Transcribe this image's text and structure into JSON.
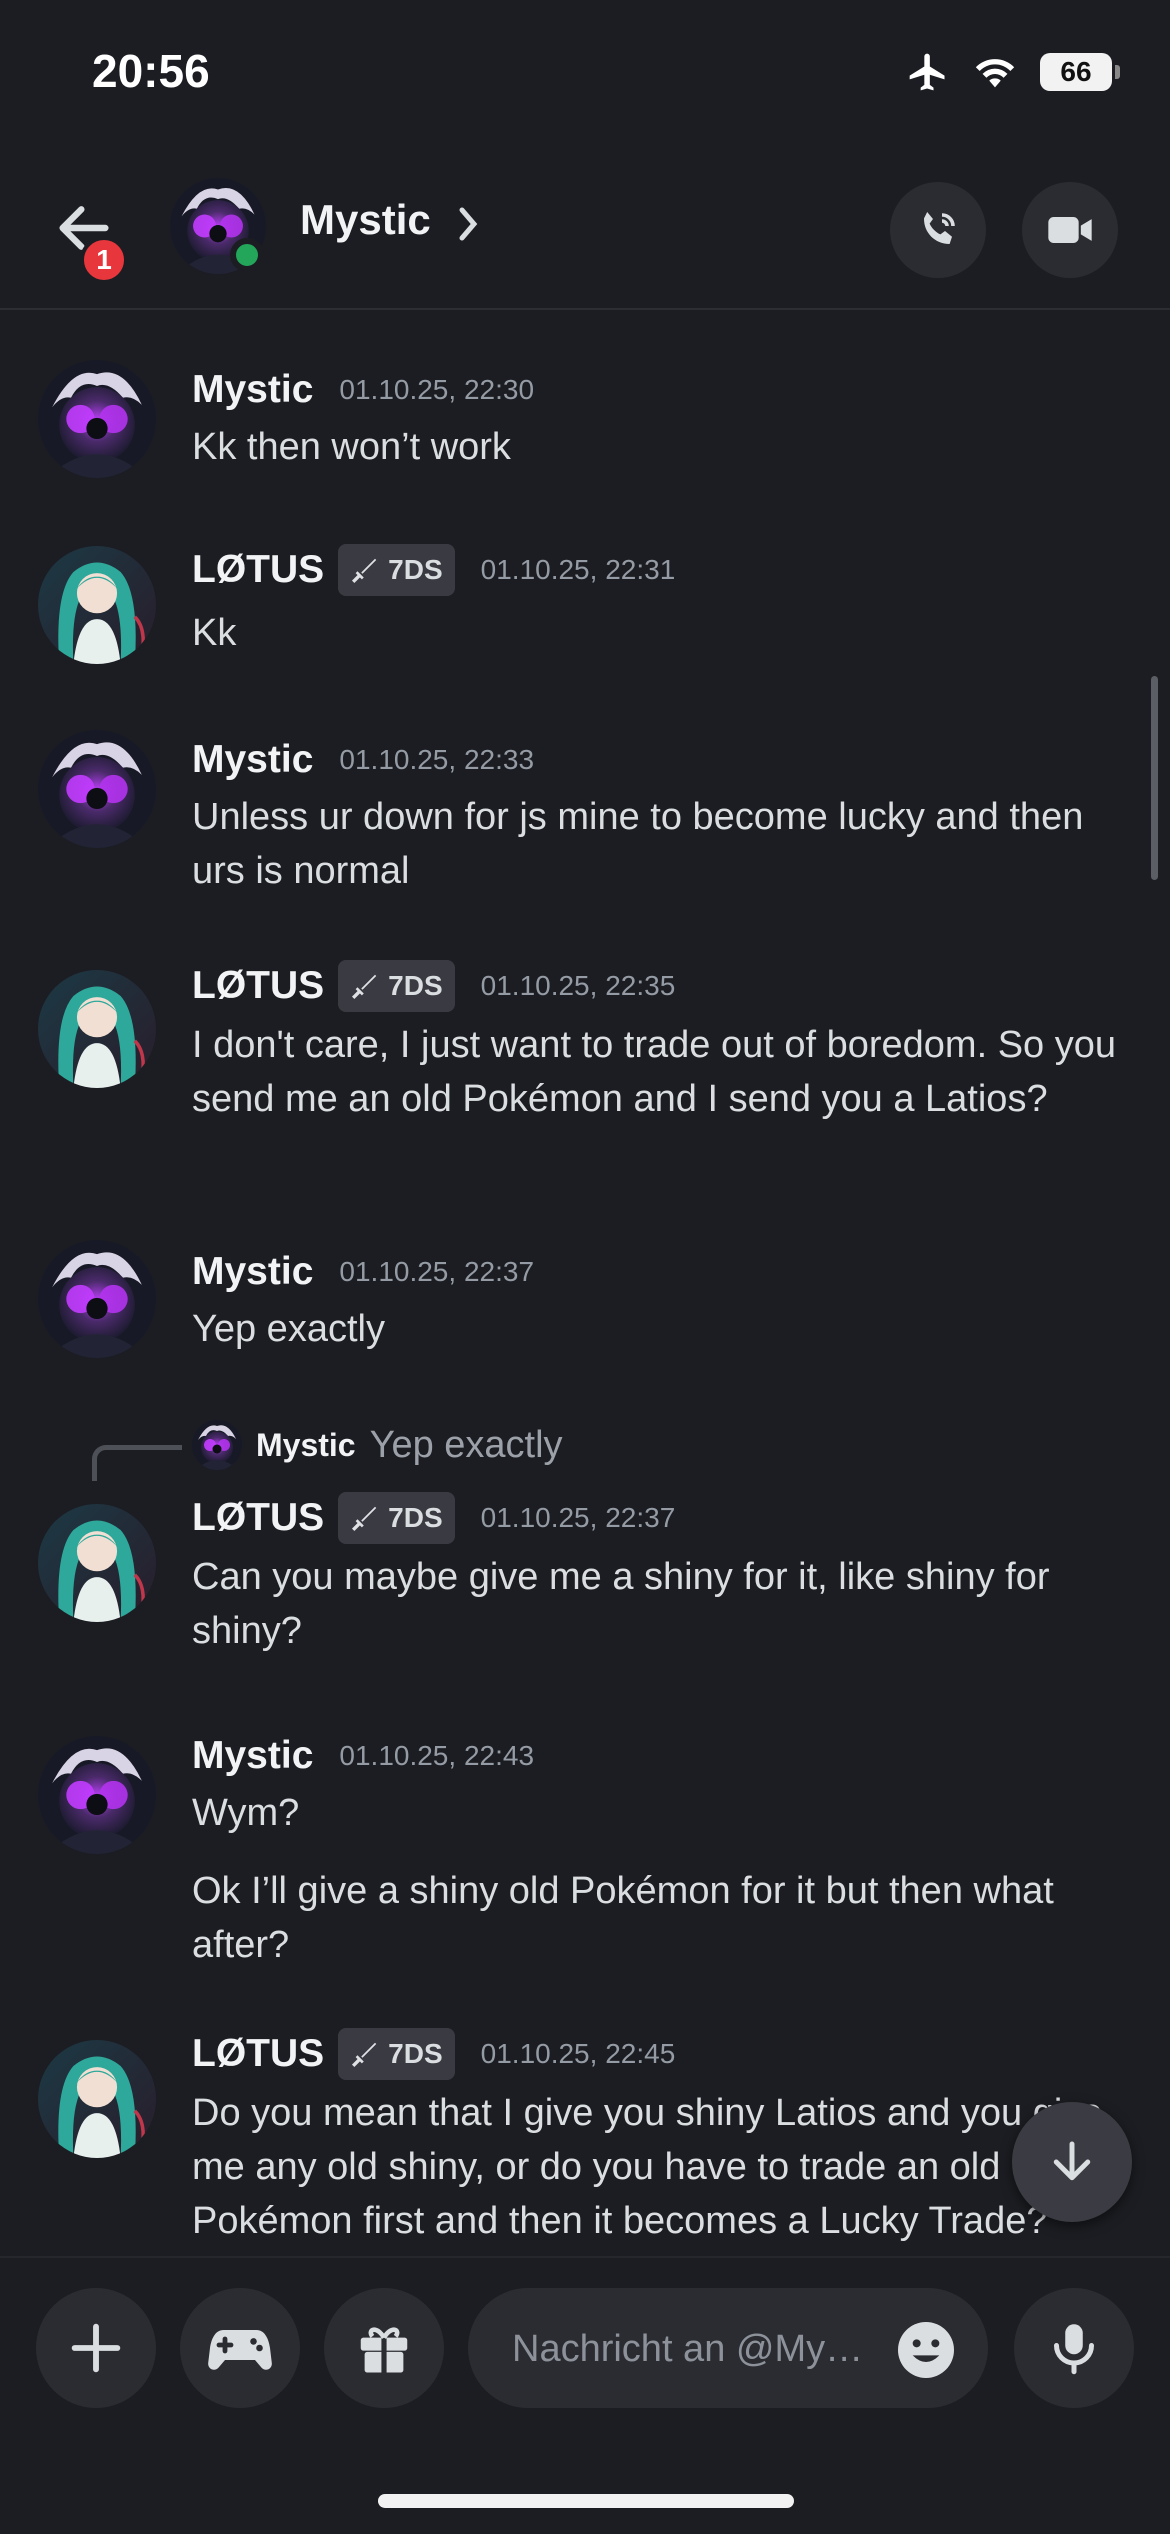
{
  "status_bar": {
    "time": "20:56",
    "battery": "66"
  },
  "header": {
    "title": "Mystic",
    "notification_count": "1"
  },
  "composer": {
    "placeholder": "Nachricht an @My…"
  },
  "messages": [
    {
      "author": "Mystic",
      "time": "01.10.25, 22:30",
      "text": "Kk then won’t work"
    },
    {
      "author": "LØTUS",
      "role": "7DS",
      "time": "01.10.25, 22:31",
      "text": "Kk"
    },
    {
      "author": "Mystic",
      "time": "01.10.25, 22:33",
      "text": "Unless ur down for js mine to become lucky and then urs is normal"
    },
    {
      "author": "LØTUS",
      "role": "7DS",
      "time": "01.10.25, 22:35",
      "text": "I don't care, I just want to trade out of boredom. So you send me an old Pokémon and I send you a Latios?"
    },
    {
      "author": "Mystic",
      "time": "01.10.25, 22:37",
      "text": "Yep exactly"
    },
    {
      "reply_to": {
        "author": "Mystic",
        "text": "Yep exactly"
      },
      "author": "LØTUS",
      "role": "7DS",
      "time": "01.10.25, 22:37",
      "text": "Can you maybe give me a shiny for it, like shiny for shiny?"
    },
    {
      "author": "Mystic",
      "time": "01.10.25, 22:43",
      "text": "Wym?",
      "text2": "Ok I’ll give a shiny old Pokémon for it but then what after?"
    },
    {
      "author": "LØTUS",
      "role": "7DS",
      "time": "01.10.25, 22:45",
      "text": "Do you mean that I give you shiny Latios and you give me any old shiny, or do you have to trade an old Pokémon first and then it becomes a Lucky Trade?"
    }
  ],
  "colors": {
    "online": "#23a55a",
    "badge": "#e8363d",
    "background": "#1c1d22"
  },
  "icons": [
    "back-arrow-icon",
    "chevron-right-icon",
    "phone-icon",
    "video-camera-icon",
    "plus-icon",
    "gamepad-icon",
    "gift-icon",
    "emoji-icon",
    "microphone-icon",
    "arrow-down-icon",
    "sword-icon",
    "airplane-icon",
    "wifi-icon"
  ]
}
